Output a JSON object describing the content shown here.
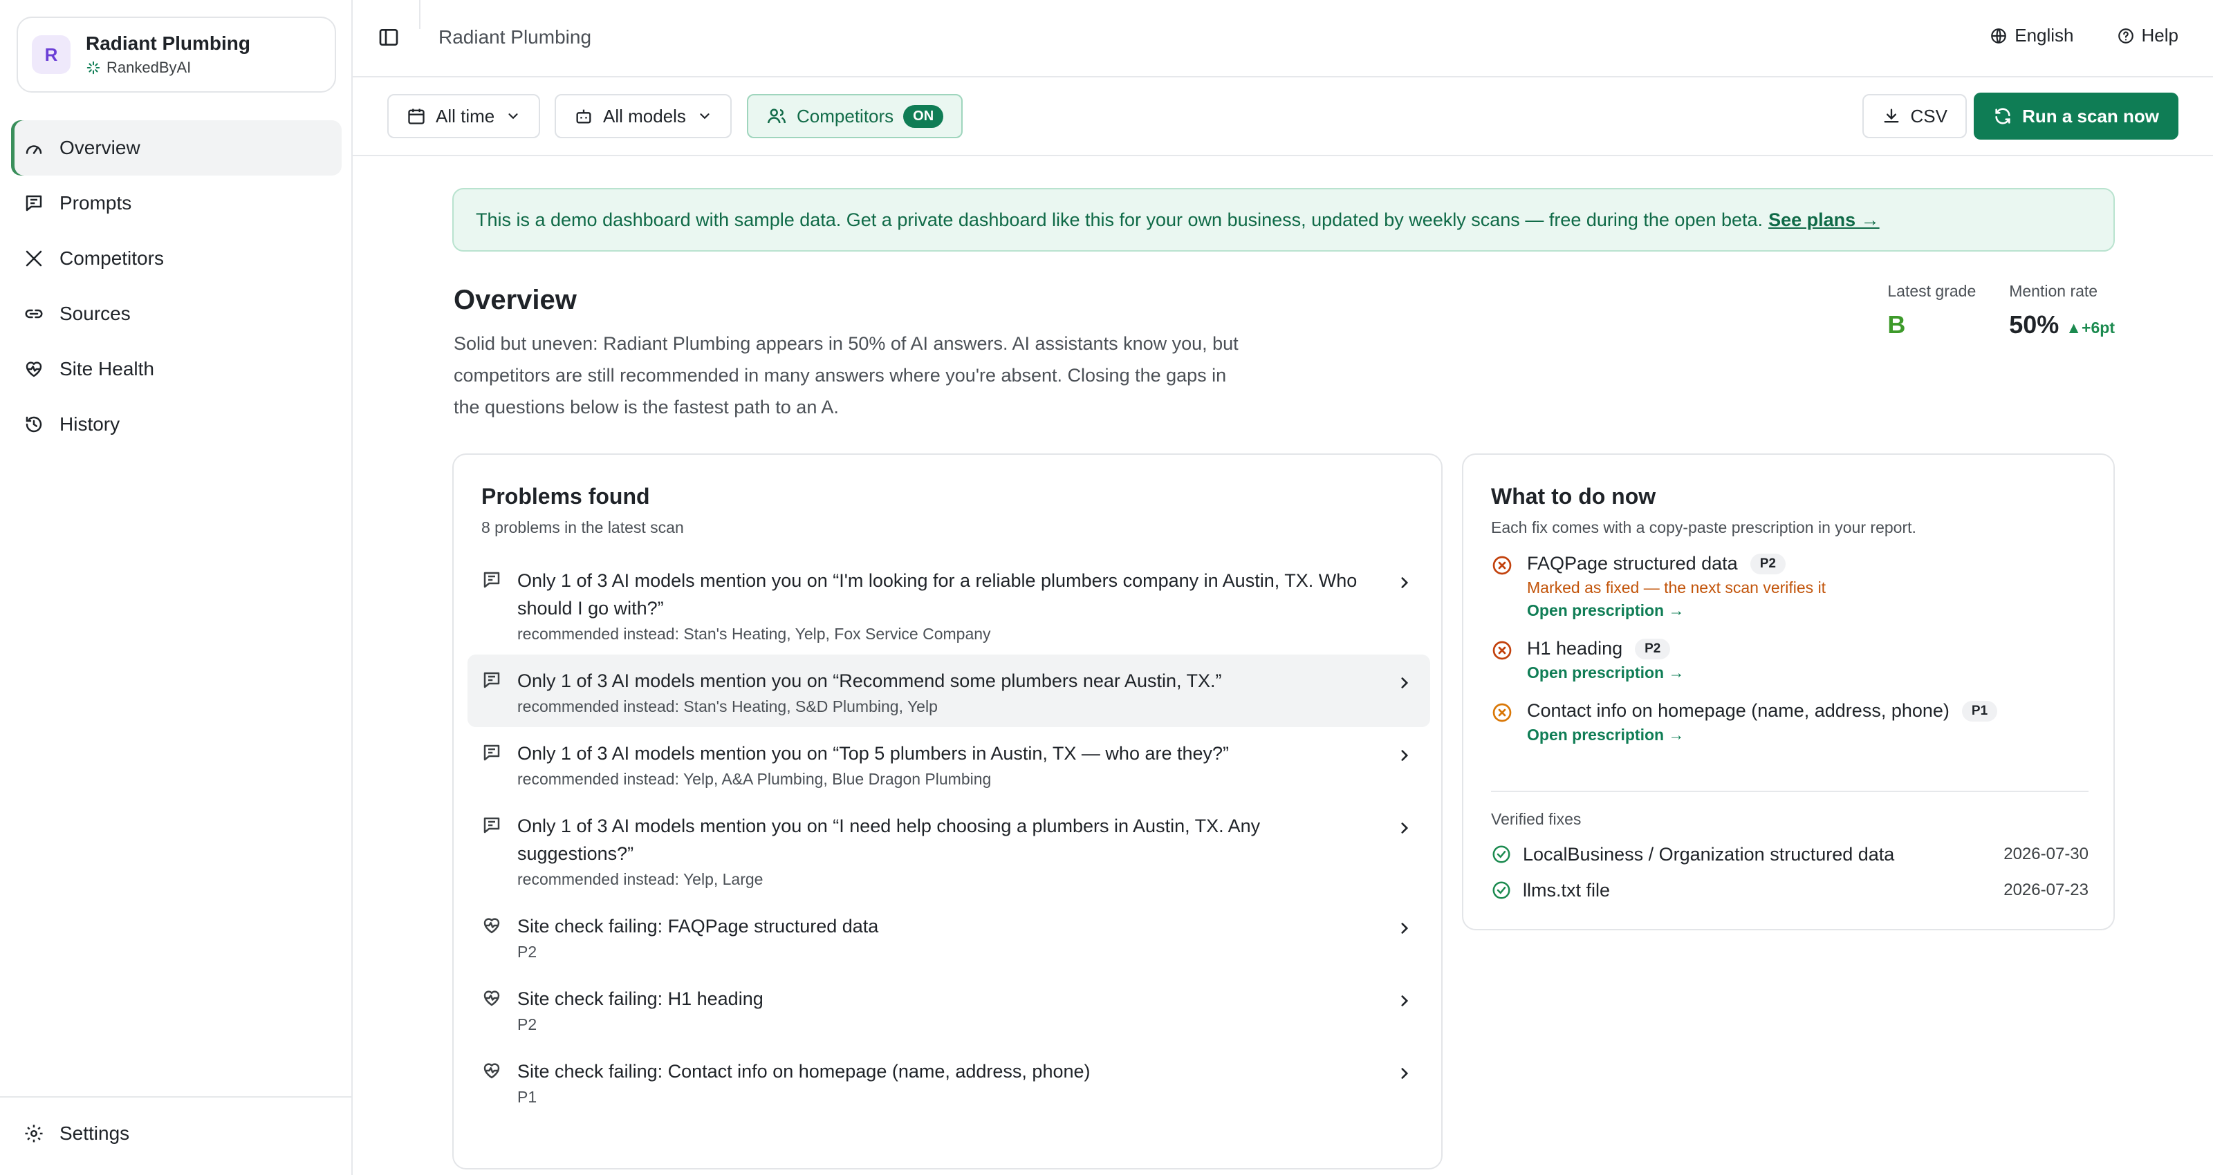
{
  "workspace": {
    "avatar": "R",
    "name": "Radiant Plumbing",
    "brand": "RankedByAI"
  },
  "nav": {
    "items": [
      {
        "label": "Overview",
        "icon": "gauge-icon"
      },
      {
        "label": "Prompts",
        "icon": "message-icon"
      },
      {
        "label": "Competitors",
        "icon": "swords-icon"
      },
      {
        "label": "Sources",
        "icon": "link-icon"
      },
      {
        "label": "Site Health",
        "icon": "heart-pulse-icon"
      },
      {
        "label": "History",
        "icon": "history-icon"
      }
    ],
    "settings": "Settings"
  },
  "topbar": {
    "title": "Radiant Plumbing",
    "language": "English",
    "help": "Help"
  },
  "filters": {
    "time": "All time",
    "models": "All models",
    "competitors": "Competitors",
    "competitors_state": "ON",
    "csv": "CSV",
    "run": "Run a scan now"
  },
  "banner": {
    "text": "This is a demo dashboard with sample data. Get a private dashboard like this for your own business, updated by weekly scans — free during the open beta.",
    "link": "See plans →"
  },
  "overview": {
    "title": "Overview",
    "description": "Solid but uneven: Radiant Plumbing appears in 50% of AI answers. AI assistants know you, but competitors are still recommended in many answers where you're absent. Closing the gaps in the questions below is the fastest path to an A.",
    "grade_label": "Latest grade",
    "grade": "B",
    "rate_label": "Mention rate",
    "rate": "50%",
    "rate_delta": "▲+6pt"
  },
  "problems": {
    "title": "Problems found",
    "subtitle": "8 problems in the latest scan",
    "items": [
      {
        "title": "Only 1 of 3 AI models mention you on “I'm looking for a reliable plumbers company in Austin, TX. Who should I go with?”",
        "sub": "recommended instead: Stan's Heating, Yelp, Fox Service Company",
        "icon": "message-icon"
      },
      {
        "title": "Only 1 of 3 AI models mention you on “Recommend some plumbers near Austin, TX.”",
        "sub": "recommended instead: Stan's Heating, S&D Plumbing, Yelp",
        "icon": "message-icon"
      },
      {
        "title": "Only 1 of 3 AI models mention you on “Top 5 plumbers in Austin, TX — who are they?”",
        "sub": "recommended instead: Yelp, A&A Plumbing, Blue Dragon Plumbing",
        "icon": "message-icon"
      },
      {
        "title": "Only 1 of 3 AI models mention you on “I need help choosing a plumbers in Austin, TX. Any suggestions?”",
        "sub": "recommended instead: Yelp, Large",
        "icon": "message-icon"
      },
      {
        "title": "Site check failing: FAQPage structured data",
        "sub": "P2",
        "icon": "heart-pulse-icon"
      },
      {
        "title": "Site check failing: H1 heading",
        "sub": "P2",
        "icon": "heart-pulse-icon"
      },
      {
        "title": "Site check failing: Contact info on homepage (name, address, phone)",
        "sub": "P1",
        "icon": "heart-pulse-icon"
      }
    ]
  },
  "todo": {
    "title": "What to do now",
    "subtitle": "Each fix comes with a copy-paste prescription in your report.",
    "items": [
      {
        "name": "FAQPage structured data",
        "priority": "P2",
        "note": "Marked as fixed — the next scan verifies it",
        "link": "Open prescription →"
      },
      {
        "name": "H1 heading",
        "priority": "P2",
        "link": "Open prescription →"
      },
      {
        "name": "Contact info on homepage (name, address, phone)",
        "priority": "P1",
        "link": "Open prescription →"
      }
    ],
    "verified_label": "Verified fixes",
    "verified": [
      {
        "name": "LocalBusiness / Organization structured data",
        "date": "2026-07-30"
      },
      {
        "name": "llms.txt file",
        "date": "2026-07-23"
      }
    ]
  },
  "colors": {
    "accent": "#0f7d55",
    "warning": "#c2540a",
    "grade": "#3d9a2a",
    "banner_bg": "#eaf7f1"
  }
}
